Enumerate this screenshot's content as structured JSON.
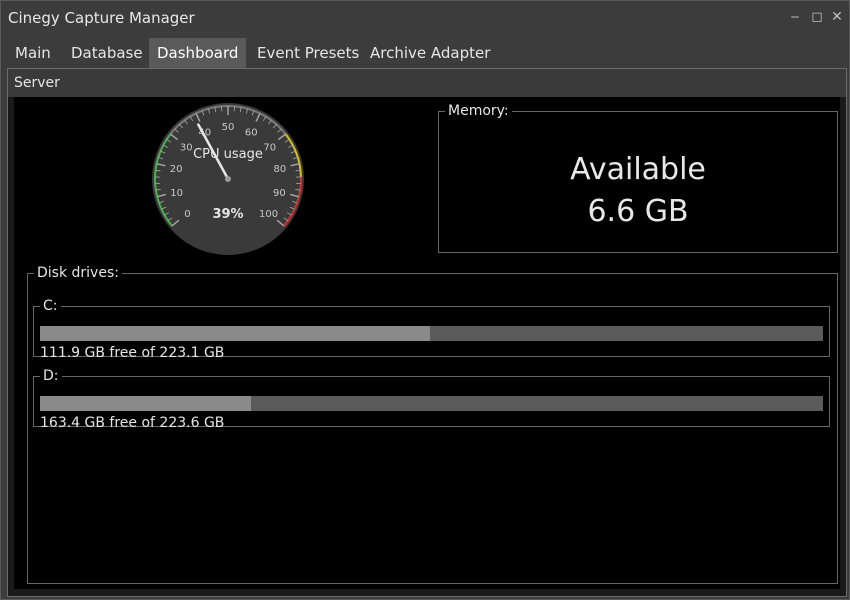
{
  "window": {
    "title": "Cinegy Capture Manager"
  },
  "title_buttons": {
    "minimize": "‒",
    "maximize": "◻",
    "close": "✕"
  },
  "tabs": [
    {
      "label": "Main",
      "active": false
    },
    {
      "label": "Database",
      "active": false
    },
    {
      "label": "Dashboard",
      "active": true
    },
    {
      "label": "Event Presets",
      "active": false
    },
    {
      "label": "Archive Adapter",
      "active": false
    }
  ],
  "panel": {
    "title": "Server"
  },
  "cpu_gauge": {
    "label": "CPU usage",
    "value": 39,
    "value_text": "39%",
    "min": 0,
    "max": 100,
    "ticks": [
      "0",
      "10",
      "20",
      "30",
      "40",
      "50",
      "60",
      "70",
      "80",
      "90",
      "100"
    ]
  },
  "memory": {
    "legend": "Memory:",
    "line1": "Available",
    "line2": "6.6 GB"
  },
  "disks": {
    "legend": "Disk drives:",
    "drives": [
      {
        "name": "C:",
        "free_gb": 111.9,
        "total_gb": 223.1,
        "text": "111.9 GB free of 223.1 GB",
        "used_fraction": 0.498
      },
      {
        "name": "D:",
        "free_gb": 163.4,
        "total_gb": 223.6,
        "text": "163.4 GB free of 223.6 GB",
        "used_fraction": 0.269
      }
    ]
  },
  "colors": {
    "gauge_face": "#3a3a3a",
    "gauge_band_low": "#4caf50",
    "gauge_band_mid": "#d4c21c",
    "gauge_band_high": "#d32f2f",
    "bar_track": "#5a5a5a",
    "bar_fill": "#8a8a8a"
  }
}
